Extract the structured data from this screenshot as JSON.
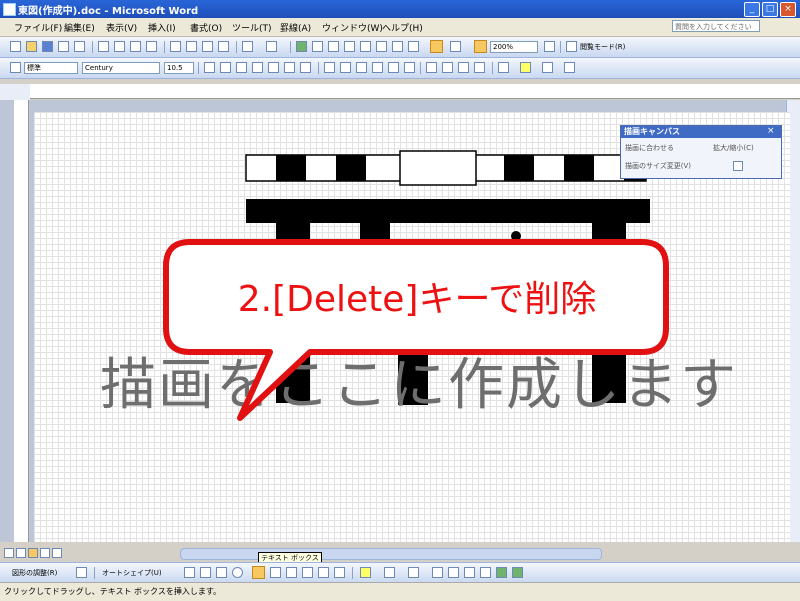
{
  "window": {
    "title": "東図(作成中).doc - Microsoft Word"
  },
  "menu": [
    "ファイル(F)",
    "編集(E)",
    "表示(V)",
    "挿入(I)",
    "書式(O)",
    "ツール(T)",
    "罫線(A)",
    "ウィンドウ(W)",
    "ヘルプ(H)"
  ],
  "help_box": {
    "placeholder": "質問を入力してください"
  },
  "standard_toolbar": {
    "zoom": "200%",
    "reading_mode": "閲覧モード(R)"
  },
  "format_toolbar": {
    "style": "標準",
    "font": "Century",
    "size": "10.5"
  },
  "canvas": {
    "placeholder_text": "描画をここに作成します"
  },
  "canvas_toolbar": {
    "title": "描画キャンバス",
    "items": [
      "描画に合わせる",
      "拡大/縮小(C)",
      "描画のサイズ変更(V)"
    ]
  },
  "callout": {
    "text": "2.[Delete]キーで削除"
  },
  "drawing_toolbar": {
    "draw_menu": "図形の調整(R)",
    "autoshapes": "オートシェイプ(U)",
    "tooltip": "テキスト ボックス"
  },
  "status": {
    "text": "クリックしてドラッグし、テキスト ボックスを挿入します。"
  },
  "colors": {
    "callout_red": "#e11111",
    "title_blue": "#1f4fb8",
    "placeholder_gray": "#6e6e6e"
  }
}
